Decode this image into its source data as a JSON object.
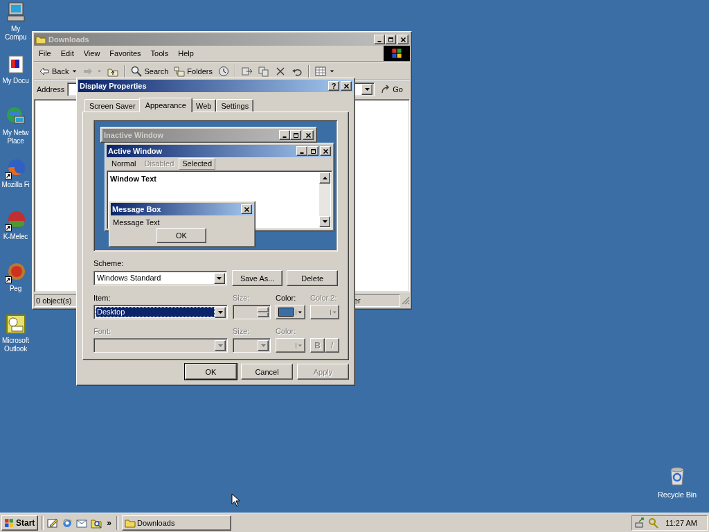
{
  "desktop_icons": [
    {
      "kind": "computer",
      "label": "My Compu",
      "shortcut": false
    },
    {
      "kind": "documents",
      "label": "My Docu",
      "shortcut": false
    },
    {
      "kind": "network",
      "label": "My Netw Place",
      "shortcut": false
    },
    {
      "kind": "firefox",
      "label": "Mozilla Fi",
      "shortcut": true
    },
    {
      "kind": "kmeleon",
      "label": "K-Melec",
      "shortcut": true
    },
    {
      "kind": "pegasus",
      "label": "Peg",
      "shortcut": true
    },
    {
      "kind": "outlook",
      "label": "Microsoft Outlook",
      "shortcut": false
    }
  ],
  "recycle_bin": {
    "label": "Recycle Bin"
  },
  "explorer": {
    "title": "Downloads",
    "active": false,
    "menu": [
      "File",
      "Edit",
      "View",
      "Favorites",
      "Tools",
      "Help"
    ],
    "toolbar": [
      {
        "kind": "back",
        "label": "Back",
        "dropdown": true,
        "disabled": false
      },
      {
        "kind": "forward",
        "dropdown": true,
        "disabled": true
      },
      {
        "kind": "up",
        "dropdown": false,
        "disabled": false
      },
      {
        "kind": "separator"
      },
      {
        "kind": "search",
        "label": "Search",
        "dropdown": false,
        "disabled": false
      },
      {
        "kind": "folders",
        "label": "Folders",
        "dropdown": false,
        "disabled": false
      },
      {
        "kind": "history",
        "dropdown": false,
        "disabled": false
      },
      {
        "kind": "separator"
      },
      {
        "kind": "move",
        "dropdown": false,
        "disabled": false
      },
      {
        "kind": "copy",
        "dropdown": false,
        "disabled": false
      },
      {
        "kind": "delete",
        "dropdown": false,
        "disabled": false
      },
      {
        "kind": "undo",
        "dropdown": false,
        "disabled": false
      },
      {
        "kind": "separator"
      },
      {
        "kind": "views",
        "dropdown": true,
        "disabled": false
      }
    ],
    "address": {
      "label": "Address",
      "go": "Go"
    },
    "status": [
      "0 object(s)",
      "er"
    ]
  },
  "dialog": {
    "title": "Display Properties",
    "help": "?",
    "tabs": [
      {
        "label": "Screen Saver",
        "selected": false
      },
      {
        "label": "Appearance",
        "selected": true
      },
      {
        "label": "Web",
        "selected": false
      },
      {
        "label": "Settings",
        "selected": false
      }
    ],
    "preview": {
      "inactive_title": "Inactive Window",
      "active_title": "Active Window",
      "menu": [
        {
          "label": "Normal",
          "disabled": false,
          "selected": false
        },
        {
          "label": "Disabled",
          "disabled": true,
          "selected": false
        },
        {
          "label": "Selected",
          "disabled": false,
          "selected": true
        }
      ],
      "window_text": "Window Text",
      "message_title": "Message Box",
      "message_text": "Message Text",
      "message_button": "OK"
    },
    "scheme": {
      "label": "Scheme:",
      "value": "Windows Standard",
      "buttons": [
        "Save As...",
        "Delete"
      ]
    },
    "item": {
      "label": "Item:",
      "value": "Desktop",
      "size": {
        "label": "Size:",
        "disabled": true
      },
      "color": {
        "label": "Color:",
        "disabled": false,
        "color": "#3a6ea5"
      },
      "color2": {
        "label": "Color 2:",
        "disabled": true
      }
    },
    "font": {
      "label": "Font:",
      "disabled": true,
      "size_label": "Size:",
      "color_label": "Color:",
      "bold": "B",
      "italic": "I"
    },
    "buttons": [
      {
        "label": "OK",
        "default": true,
        "disabled": false
      },
      {
        "label": "Cancel",
        "default": false,
        "disabled": false
      },
      {
        "label": "Apply",
        "default": false,
        "disabled": true
      }
    ]
  },
  "taskbar": {
    "start": "Start",
    "quick_launch": [
      {
        "kind": "desktop"
      },
      {
        "kind": "browser"
      },
      {
        "kind": "mail"
      },
      {
        "kind": "qsearch"
      }
    ],
    "more": "»",
    "tasks": [
      {
        "label": "Downloads",
        "selected": false
      }
    ],
    "tray": [
      {
        "kind": "network"
      },
      {
        "kind": "key"
      }
    ],
    "clock": "11:27 AM"
  }
}
